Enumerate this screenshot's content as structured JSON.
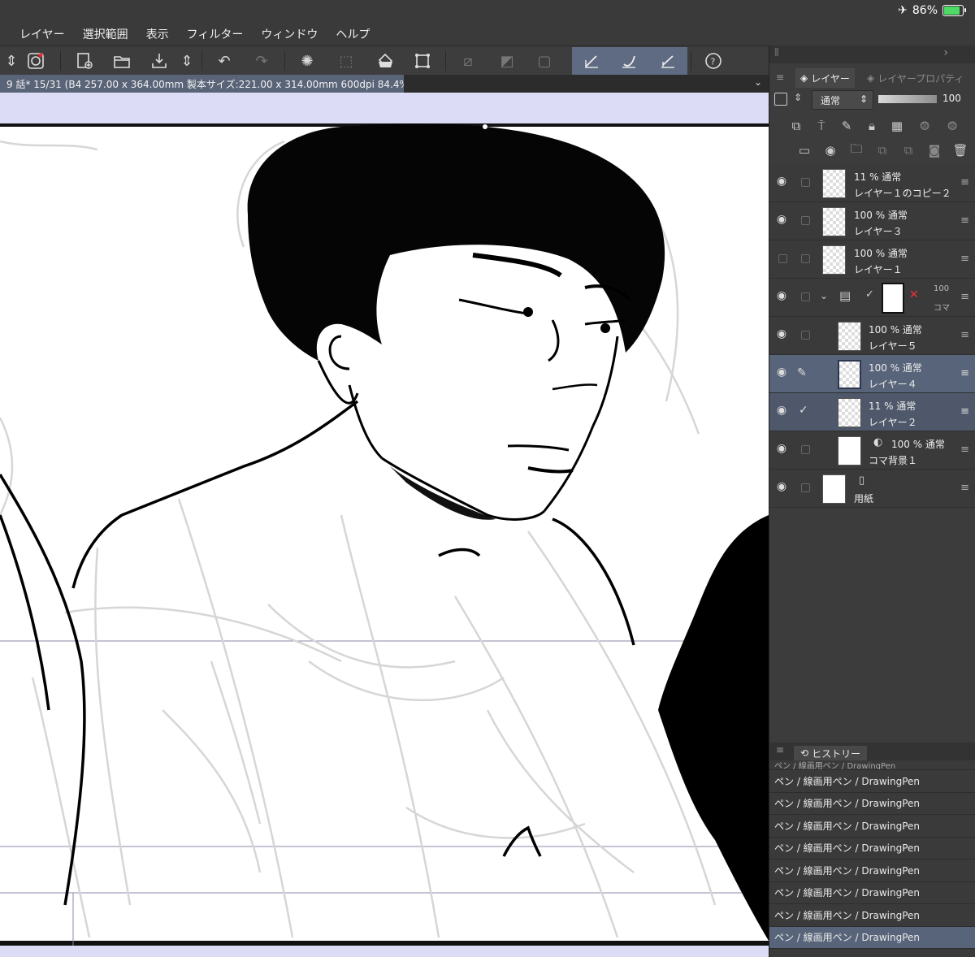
{
  "status": {
    "battery": "86%",
    "battery_level": 0.86
  },
  "menu": [
    "レイヤー",
    "選択範囲",
    "表示",
    "フィルター",
    "ウィンドウ",
    "ヘルプ"
  ],
  "toolbar_icons": [
    "spin-icon",
    "logo-icon",
    "new-document-icon",
    "open-folder-icon",
    "export-icon",
    "spin-icon",
    "undo-icon",
    "redo-icon",
    "loading-icon",
    "transform-icon",
    "fill-icon",
    "crop-icon",
    "deselect-icon",
    "invert-icon",
    "border-icon",
    "pen-icon",
    "brush-icon",
    "eraser-icon",
    "help-icon"
  ],
  "document": {
    "tab_label": "9 話* 15/31 (B4 257.00 x 364.00mm 製本サイズ:221.00 x 314.00mm 600dpi 84.4%)"
  },
  "layer_panel": {
    "tab_layer": "レイヤー",
    "tab_property": "レイヤープロパティ",
    "blend_mode": "通常",
    "opacity": "100"
  },
  "layers": [
    {
      "top": "11 % 通常",
      "name": "レイヤー１のコピー２",
      "visible": true,
      "state": "normal"
    },
    {
      "top": "100 % 通常",
      "name": "レイヤー３",
      "visible": true,
      "state": "normal"
    },
    {
      "top": "100 % 通常",
      "name": "レイヤー１",
      "visible": false,
      "state": "normal"
    },
    {
      "top": "100",
      "name": "コマ",
      "visible": true,
      "state": "folder"
    },
    {
      "top": "100 % 通常",
      "name": "レイヤー５",
      "visible": true,
      "state": "child"
    },
    {
      "top": "100 % 通常",
      "name": "レイヤー４",
      "visible": true,
      "state": "selected"
    },
    {
      "top": "11 % 通常",
      "name": "レイヤー２",
      "visible": true,
      "state": "subselected"
    },
    {
      "top": "100 % 通常",
      "name": "コマ背景１",
      "visible": true,
      "state": "child"
    },
    {
      "top": "",
      "name": "用紙",
      "visible": true,
      "state": "paper"
    }
  ],
  "history": {
    "tab": "ヒストリー",
    "items": [
      "ペン / 線画用ペン / DrawingPen",
      "ペン / 線画用ペン / DrawingPen",
      "ペン / 線画用ペン / DrawingPen",
      "ペン / 線画用ペン / DrawingPen",
      "ペン / 線画用ペン / DrawingPen",
      "ペン / 線画用ペン / DrawingPen",
      "ペン / 線画用ペン / DrawingPen",
      "ペン / 線画用ペン / DrawingPen",
      "ペン / 線画用ペン / DrawingPen"
    ]
  }
}
